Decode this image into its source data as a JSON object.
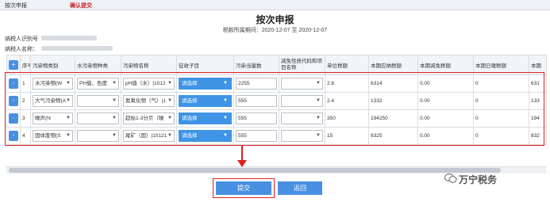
{
  "topbar": {
    "tab1": "按次申报",
    "tab2": "确认提交"
  },
  "page": {
    "title": "按次申报",
    "period_label": "税款所属期间：2020-12-07 至 2020-12-07"
  },
  "taxpayer": {
    "id_label": "纳税人识别号",
    "name_label": "纳税人名称："
  },
  "table": {
    "headers": [
      "序号",
      "污染物类别",
      "水污染物种类",
      "污染物名称",
      "征收子目",
      "污染当量数",
      "减免性质代码和项目名称",
      "单位税额",
      "本期应纳税额",
      "本期减免税额",
      "本期已缴税额",
      "本期"
    ],
    "choose_label": "请选择",
    "rows": [
      {
        "no": "1",
        "category": "水污染物(W",
        "water_type": "PH值、色度",
        "pollutant": "pH值（水）|1012",
        "equivalent": "2255",
        "unit_tax": "2.8",
        "payable": "6314",
        "relief": "0.00",
        "paid": "0",
        "extra": "631"
      },
      {
        "no": "2",
        "category": "大气污染物(A",
        "water_type": "",
        "pollutant": "氮氧化物（气）|1",
        "equivalent": "555",
        "unit_tax": "2.4",
        "payable": "1332",
        "relief": "0.00",
        "paid": "0",
        "extra": "133"
      },
      {
        "no": "3",
        "category": "噪声(N",
        "water_type": "",
        "pollutant": "超标1-3分贝（噪",
        "equivalent": "555",
        "unit_tax": "350",
        "payable": "194250",
        "relief": "0.00",
        "paid": "0",
        "extra": "194"
      },
      {
        "no": "4",
        "category": "固体废物(S",
        "water_type": "",
        "pollutant": "尾矿（固）|10121",
        "equivalent": "555",
        "unit_tax": "15",
        "payable": "8325",
        "relief": "0.00",
        "paid": "0",
        "extra": "832"
      }
    ]
  },
  "buttons": {
    "add": "+",
    "row_minus": "-",
    "submit": "提交",
    "back": "返回"
  },
  "watermark": {
    "text": "万宁税务"
  },
  "colors": {
    "accent": "#4a90e2",
    "highlight": "#e02020"
  }
}
